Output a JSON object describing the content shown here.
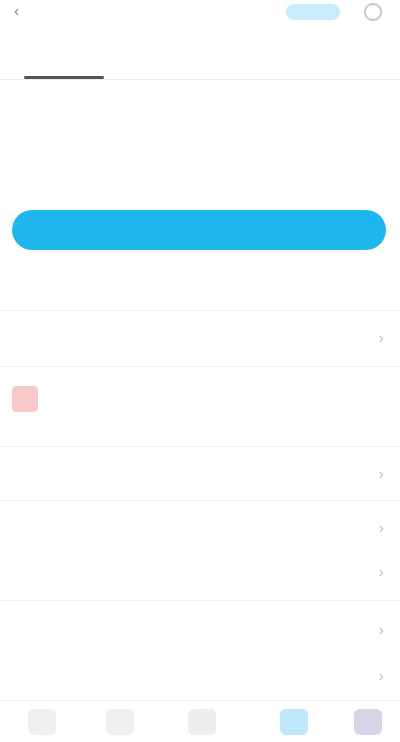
{
  "header": {
    "back_icon": "back-icon",
    "title": "",
    "pill": "",
    "right_icon": "help-icon"
  },
  "tabs": [
    {
      "label": "",
      "active": true
    },
    {
      "label": "",
      "active": false
    },
    {
      "label": "",
      "active": false
    }
  ],
  "balance": {
    "value": "",
    "unit": "",
    "note": ""
  },
  "primary_button": {
    "label": ""
  },
  "disclaimer": "",
  "rows": [
    {
      "label": "",
      "value": ""
    },
    {
      "label": "",
      "value": ""
    },
    {
      "label": "",
      "value": ""
    },
    {
      "label": "",
      "value": ""
    },
    {
      "label": "",
      "value": ""
    },
    {
      "label": "",
      "value": ""
    }
  ],
  "notice": {
    "text": "",
    "link": ""
  },
  "bottom_tabs": [
    {
      "icon": "home-icon"
    },
    {
      "icon": "discover-icon"
    },
    {
      "icon": "wallet-icon"
    },
    {
      "icon": "cloud-icon"
    },
    {
      "icon": "profile-icon"
    }
  ],
  "colors": {
    "accent": "#1fb6ee",
    "text": "#555555",
    "muted": "#999999",
    "divider": "#eeeeee",
    "notice_badge": "#f7c9c9"
  }
}
